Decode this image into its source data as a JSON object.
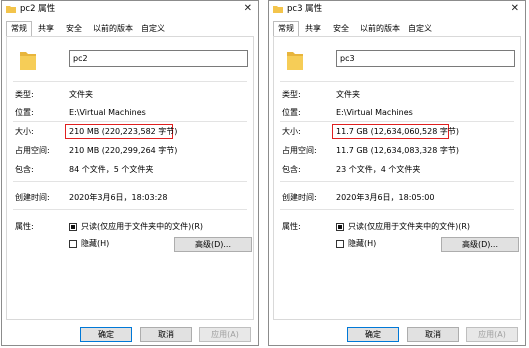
{
  "windows": [
    {
      "title": "pc2 属性",
      "tabs": [
        "常规",
        "共享",
        "安全",
        "以前的版本",
        "自定义"
      ],
      "folder_name": "pc2",
      "type_label": "类型:",
      "type_value": "文件夹",
      "location_label": "位置:",
      "location_value": "E:\\Virtual Machines",
      "size_label": "大小:",
      "size_value": "210 MB (220,223,582 字节)",
      "disk_label": "占用空间:",
      "disk_value": "210 MB (220,299,264 字节)",
      "contains_label": "包含:",
      "contains_value": "84 个文件，5 个文件夹",
      "created_label": "创建时间:",
      "created_value": "2020年3月6日，18:03:28",
      "attr_label": "属性:",
      "readonly_label": "只读(仅应用于文件夹中的文件)(R)",
      "hidden_label": "隐藏(H)",
      "advanced_label": "高级(D)...",
      "ok_label": "确定",
      "cancel_label": "取消",
      "apply_label": "应用(A)"
    },
    {
      "title": "pc3 属性",
      "tabs": [
        "常规",
        "共享",
        "安全",
        "以前的版本",
        "自定义"
      ],
      "folder_name": "pc3",
      "type_label": "类型:",
      "type_value": "文件夹",
      "location_label": "位置:",
      "location_value": "E:\\Virtual Machines",
      "size_label": "大小:",
      "size_value": "11.7 GB (12,634,060,528 字节)",
      "disk_label": "占用空间:",
      "disk_value": "11.7 GB (12,634,083,328 字节)",
      "contains_label": "包含:",
      "contains_value": "23 个文件，4 个文件夹",
      "created_label": "创建时间:",
      "created_value": "2020年3月6日，18:05:00",
      "attr_label": "属性:",
      "readonly_label": "只读(仅应用于文件夹中的文件)(R)",
      "hidden_label": "隐藏(H)",
      "advanced_label": "高级(D)...",
      "ok_label": "确定",
      "cancel_label": "取消",
      "apply_label": "应用(A)"
    }
  ],
  "colors": {
    "highlight": "#e02020",
    "folder": "#f3c44b",
    "default_button_border": "#0078d7"
  }
}
